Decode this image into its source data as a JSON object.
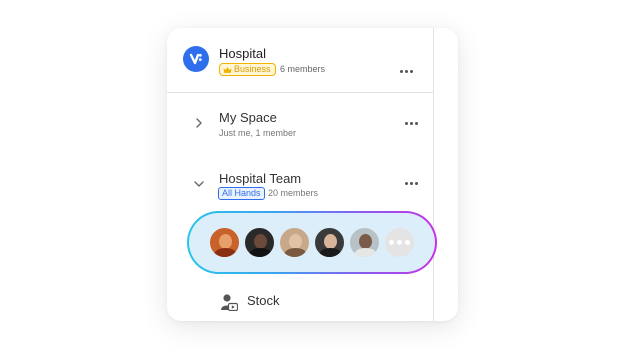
{
  "org": {
    "name": "Hospital",
    "plan_badge": "Business",
    "members": "6 members",
    "logo_color": "#2f6fed",
    "plan_color": "#f0b400"
  },
  "spaces": [
    {
      "name": "My Space",
      "subtitle": "Just me, 1 member",
      "expanded": false
    },
    {
      "name": "Hospital Team",
      "badge": "All Hands",
      "subtitle": "20 members",
      "expanded": true
    }
  ],
  "team_members": {
    "avatars": [
      "avatar-1",
      "avatar-2",
      "avatar-3",
      "avatar-4",
      "avatar-5"
    ],
    "more_icon": "more-members-icon",
    "gradient": [
      "#26c6e8",
      "#c832e6"
    ]
  },
  "stock": {
    "label": "Stock",
    "icon": "stock-media-icon"
  }
}
